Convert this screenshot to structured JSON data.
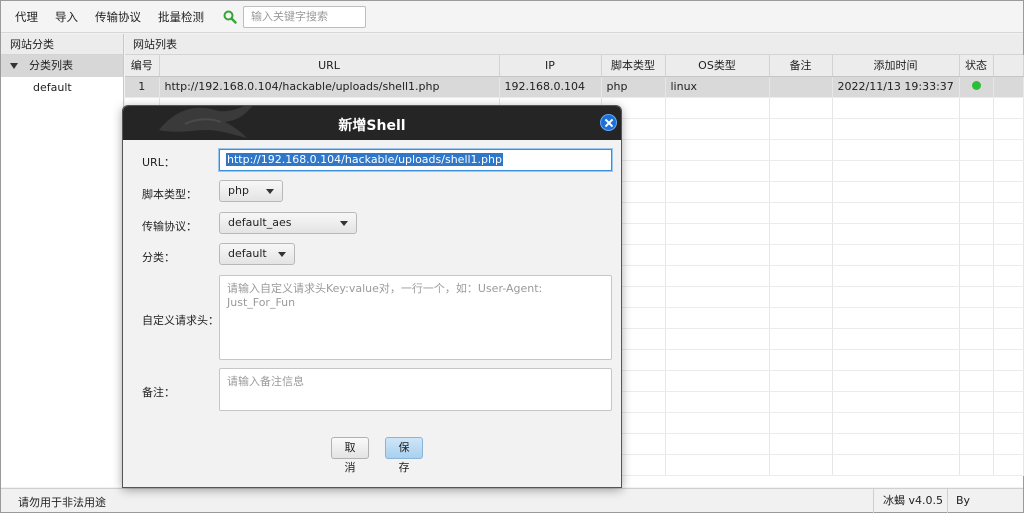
{
  "toolbar": {
    "menus": [
      "代理",
      "导入",
      "传输协议",
      "批量检测"
    ],
    "search_placeholder": "输入关键字搜索"
  },
  "left_panel": {
    "header": "网站分类",
    "root": "分类列表",
    "children": [
      "default"
    ]
  },
  "right_panel": {
    "header": "网站列表",
    "columns": [
      "编号",
      "URL",
      "IP",
      "脚本类型",
      "OS类型",
      "备注",
      "添加时间",
      "状态"
    ],
    "rows": [
      {
        "id": "1",
        "url": "http://192.168.0.104/hackable/uploads/shell1.php",
        "ip": "192.168.0.104",
        "script": "php",
        "os": "linux",
        "note": "",
        "time": "2022/11/13 19:33:37",
        "status": "online",
        "status_color": "#2bbf38"
      }
    ]
  },
  "dialog": {
    "title": "新增Shell",
    "url_label": "URL：",
    "url_value": "http://192.168.0.104/hackable/uploads/shell1.php",
    "script_label": "脚本类型：",
    "script_value": "php",
    "protocol_label": "传输协议：",
    "protocol_value": "default_aes",
    "category_label": "分类：",
    "category_value": "default",
    "headers_label": "自定义请求头：",
    "headers_placeholder": "请输入自定义请求头Key:value对，一行一个，如：User-Agent: Just_For_Fun",
    "note_label": "备注：",
    "note_placeholder": "请输入备注信息",
    "cancel_label": "取消",
    "save_label": "保存"
  },
  "statusbar": {
    "left": "请勿用于非法用途",
    "version": "冰蝎 v4.0.5",
    "author": "By rebeyond"
  },
  "colors": {
    "title_bar": "#252525",
    "accent": "#1a6fdc",
    "selection": "#2f78c9",
    "online": "#2bbf38"
  }
}
